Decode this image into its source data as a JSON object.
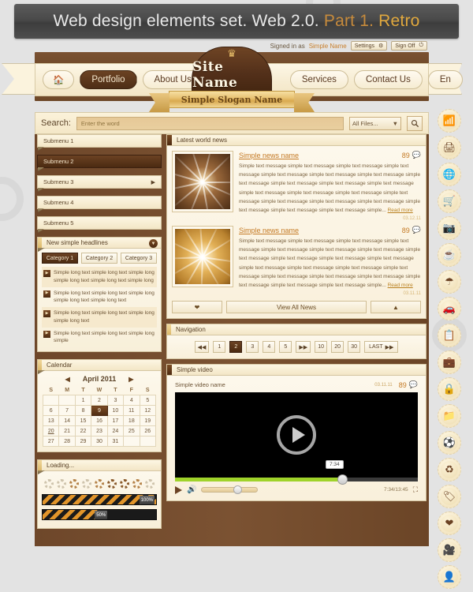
{
  "titlebar": {
    "part_a": "Web design elements set. Web 2.0.",
    "part_b": " Part 1.",
    "part_c": " Retro"
  },
  "account": {
    "signed_in_prefix": "Signed in as ",
    "user_name": "Simple Name",
    "settings_label": "Settings",
    "settings_icon": "gear-icon",
    "signoff_label": "Sign Off",
    "signoff_icon": "power-icon"
  },
  "brand": {
    "crown_icon": "crown-icon",
    "site_name": "Site Name",
    "slogan": "Simple Slogan Name"
  },
  "nav": {
    "home_icon": "home-icon",
    "items_left": [
      "Portfolio",
      "About Us"
    ],
    "items_right": [
      "Services",
      "Contact Us",
      "En"
    ],
    "active": "Portfolio"
  },
  "search": {
    "label": "Search:",
    "placeholder": "Enter the word",
    "value": "",
    "filter_selected": "All Files...",
    "filter_caret_icon": "chevron-down-icon",
    "button_icon": "search-icon"
  },
  "submenu": {
    "items": [
      {
        "label": "Submenu 1",
        "active": false,
        "has_arrow": false
      },
      {
        "label": "Submenu 2",
        "active": true,
        "has_arrow": false
      },
      {
        "label": "Submenu 3",
        "active": false,
        "has_arrow": true
      },
      {
        "label": "Submenu 4",
        "active": false,
        "has_arrow": false
      },
      {
        "label": "Submenu 5",
        "active": false,
        "has_arrow": false
      }
    ]
  },
  "headlines": {
    "title": "New simple headlines",
    "collapse_icon": "chevron-down-circle-icon",
    "tabs": [
      "Category 1",
      "Category 2",
      "Category 3"
    ],
    "active_tab": "Category 1",
    "items": [
      "Simple long text simple long text simple long simple long text simple long text simple long",
      "Simple long text simple long text simple long simple long text simple long text",
      "Simple long text simple long text simple long simple long text",
      "Simple long text simple long text simple long simple"
    ],
    "bullet_icon": "play-square-icon"
  },
  "calendar": {
    "title": "Calendar",
    "prev_icon": "triangle-left-icon",
    "next_icon": "triangle-right-icon",
    "month_label": "April 2011",
    "weekdays": [
      "S",
      "M",
      "T",
      "W",
      "T",
      "F",
      "S"
    ],
    "weeks": [
      [
        "",
        "",
        "1",
        "2",
        "3",
        "4",
        "5"
      ],
      [
        "6",
        "7",
        "8",
        "9",
        "10",
        "11",
        "12"
      ],
      [
        "13",
        "14",
        "15",
        "16",
        "17",
        "18",
        "19"
      ],
      [
        "20",
        "21",
        "22",
        "23",
        "24",
        "25",
        "26"
      ],
      [
        "27",
        "28",
        "29",
        "30",
        "31",
        "",
        ""
      ]
    ],
    "selected_day": "9",
    "underlined_days": [
      "20"
    ]
  },
  "loading": {
    "title": "Loading...",
    "spinner_count": 9,
    "bars": [
      {
        "percent": 100,
        "label": "100%",
        "label_side": "right"
      },
      {
        "percent": 50,
        "label": "50%",
        "label_side": "inline"
      }
    ]
  },
  "news": {
    "title": "Latest world news",
    "items": [
      {
        "title": "Simple news name",
        "comments": "89",
        "comment_icon": "comment-icon",
        "body": "Simple text message simple  text message simple text message simple text message simple text message simple text message simple text message simple text message simple text message simple text message simple text message simple text message simple text message simple text message simple text message simple text message simple text message simple text message simple text message simple text message simple text message simple...",
        "read_more": "Read more",
        "date": "03.12.11",
        "thumb": "star-burst-brown"
      },
      {
        "title": "Simple news name",
        "comments": "89",
        "comment_icon": "comment-icon",
        "body": "Simple text message simple  text message simple text message simple text message simple text message simple text message simple text message simple text message simple text message simple text message simple text message simple text message simple text message simple text message simple text message simple text message simple text message simple text message simple text message simple text message simple text message simple...",
        "read_more": "Read more",
        "date": "03.11.11",
        "thumb": "star-burst-gold"
      }
    ],
    "footer": {
      "favorite_icon": "heart-icon",
      "view_all_label": "View All News",
      "collapse_icon": "triangle-up-icon"
    }
  },
  "pager": {
    "title": "Navigation",
    "first_icon": "double-chevron-left-icon",
    "next_icon": "double-chevron-right-icon",
    "pages": [
      "1",
      "2",
      "3",
      "4",
      "5"
    ],
    "jumps": [
      "10",
      "20",
      "30"
    ],
    "active_page": "2",
    "last_label": "LAST"
  },
  "video": {
    "title": "Simple video",
    "name": "Simple video name",
    "date": "03.11.11",
    "comments": "89",
    "comment_icon": "comment-icon",
    "play_icon": "play-circle-icon",
    "tooltip_time": "7:34",
    "time_display": "7:34/13:45",
    "progress_percent": 69,
    "volume_percent": 56,
    "play_button_icon": "play-icon",
    "volume_icon": "speaker-icon",
    "fullscreen_icon": "fullscreen-icon"
  },
  "rail": {
    "icons": [
      "rss-icon",
      "printer-icon",
      "globe-icon",
      "cart-icon",
      "camera-icon",
      "coffee-icon",
      "umbrella-icon",
      "car-icon",
      "clipboard-icon",
      "briefcase-icon",
      "lock-icon",
      "folder-icon",
      "soccer-icon",
      "recycle-icon",
      "tag-icon",
      "heart-icon",
      "videocam-icon",
      "user-icon"
    ],
    "glyphs": [
      "◠",
      "⎙",
      "ἱ0",
      "Ὥ2",
      "὏7",
      "☕",
      "☂",
      "Ὡ7",
      "ὌB",
      "ὋC",
      "ὑ2",
      "Ὄ1",
      "⚽",
      "♻",
      "Ἷ7",
      "♥",
      "Ἲ5",
      "὆4"
    ]
  }
}
